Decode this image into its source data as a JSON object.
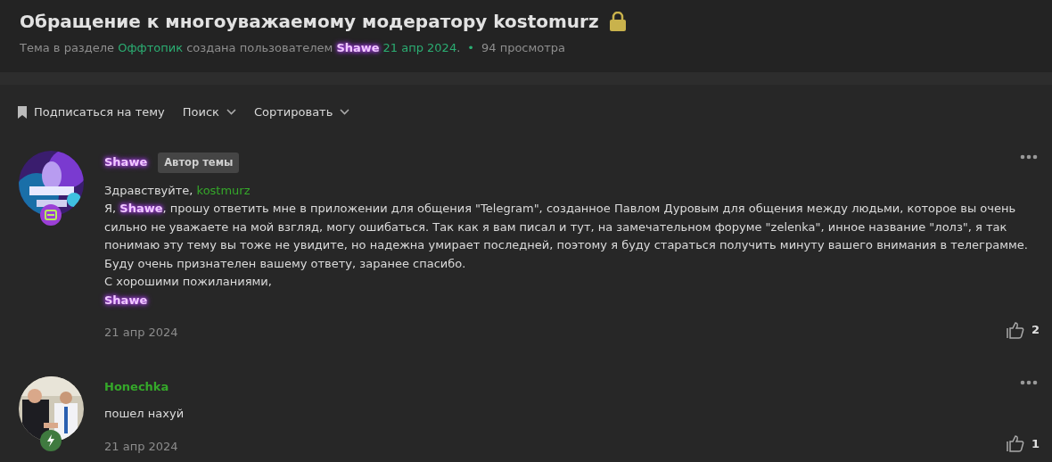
{
  "thread": {
    "title": "Обращение к многоуважаемому модератору kostomurz",
    "locked": true,
    "meta": [
      {
        "kind": "text",
        "text": "Тема в разделе "
      },
      {
        "kind": "link",
        "text": "Оффтопик"
      },
      {
        "kind": "text",
        "text": " создана пользователем "
      },
      {
        "kind": "user",
        "text": "Shawe"
      },
      {
        "kind": "link",
        "text": "21 апр 2024"
      },
      {
        "kind": "text",
        "text": "."
      }
    ],
    "views_separator": "•",
    "views": "94 просмотра"
  },
  "toolbar": [
    {
      "kind": "subscribe",
      "label": "Подписаться на тему"
    },
    {
      "kind": "dropdown",
      "label": "Поиск"
    },
    {
      "kind": "dropdown",
      "label": "Сортировать"
    }
  ],
  "posts": [
    {
      "author": {
        "name": "Shawe",
        "kind": "user"
      },
      "avatar": {
        "kind": "card"
      },
      "author_badge": "Автор темы",
      "lines": [
        [
          {
            "kind": "text",
            "text": "Здравствуйте, "
          },
          {
            "kind": "mention",
            "text": "kostmurz"
          }
        ],
        [
          {
            "kind": "text",
            "text": "Я, "
          },
          {
            "kind": "user",
            "text": "Shawe"
          },
          {
            "kind": "text",
            "text": ", прошу ответить мне в приложении для общения \"Telegram\", созданное Павлом Дуровым для общения между людьми, которое вы очень сильно не уважаете на мой взгляд, могу ошибаться. Так как я вам писал и тут, на замечательном форуме \"zelenka\", инное название \"лолз\", я так понимаю эту тему вы тоже не увидите, но надежна умирает последней, поэтому я буду стараться получить минуту вашего внимания в телеграмме."
          }
        ],
        [
          {
            "kind": "text",
            "text": "Буду очень признателен вашему ответу, заранее спасибо."
          }
        ],
        [
          {
            "kind": "text",
            "text": "С хорошими пожиланиями,"
          }
        ],
        [
          {
            "kind": "user",
            "text": "Shawe"
          }
        ]
      ],
      "date": "21 апр 2024",
      "likes": "2"
    },
    {
      "author": {
        "name": "Honechka",
        "kind": "mention"
      },
      "avatar": {
        "kind": "bolt"
      },
      "lines": [
        [
          {
            "kind": "text",
            "text": "пошел нахуй"
          }
        ]
      ],
      "date": "21 апр 2024",
      "likes": "1"
    }
  ]
}
